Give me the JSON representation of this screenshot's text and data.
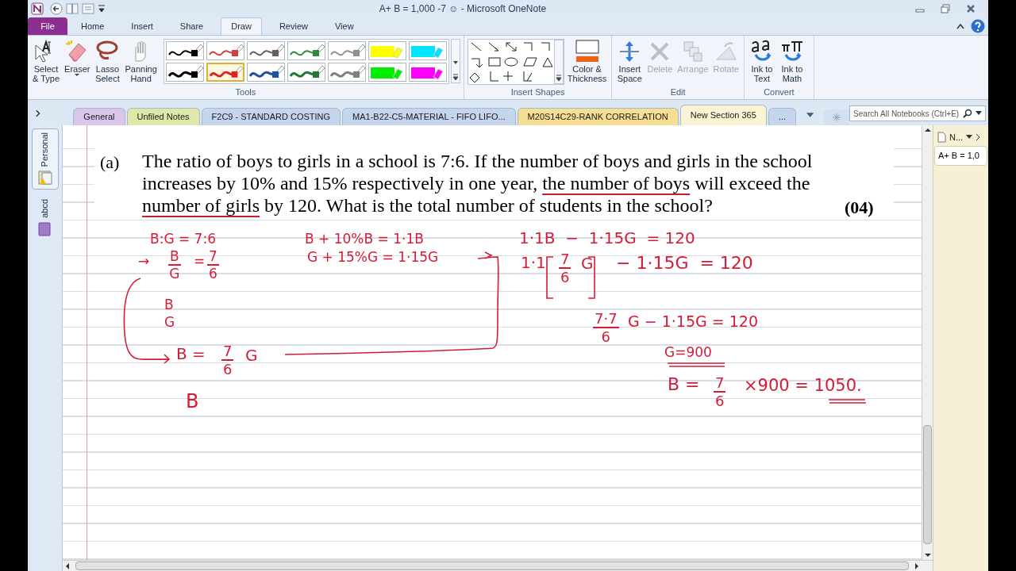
{
  "window": {
    "title": "A+ B = 1,000 -7 ☺  -  Microsoft OneNote"
  },
  "ribbon_tabs": [
    {
      "label": "File",
      "kind": "file",
      "selected": false
    },
    {
      "label": "Home",
      "kind": "tab",
      "selected": false
    },
    {
      "label": "Insert",
      "kind": "tab",
      "selected": false
    },
    {
      "label": "Share",
      "kind": "tab",
      "selected": false
    },
    {
      "label": "Draw",
      "kind": "tab",
      "selected": true
    },
    {
      "label": "Review",
      "kind": "tab",
      "selected": false
    },
    {
      "label": "View",
      "kind": "tab",
      "selected": false
    }
  ],
  "ribbon": {
    "tools": {
      "label": "Tools",
      "buttons": [
        {
          "label": "Select\n& Type",
          "kind": "select"
        },
        {
          "label": "Eraser",
          "kind": "eraser"
        },
        {
          "label": "Lasso\nSelect",
          "kind": "lasso"
        },
        {
          "label": "Panning\nHand",
          "kind": "hand"
        }
      ],
      "pens": [
        {
          "kind": "pen",
          "color": "#000000",
          "selected": false
        },
        {
          "kind": "pen",
          "color": "#d04040",
          "selected": false
        },
        {
          "kind": "pen",
          "color": "#606060",
          "selected": false
        },
        {
          "kind": "pen",
          "color": "#2e8b3e",
          "selected": false
        },
        {
          "kind": "pen",
          "color": "#909090",
          "selected": false
        },
        {
          "kind": "highlighter",
          "color": "#ffff00",
          "selected": false
        },
        {
          "kind": "highlighter",
          "color": "#00e5ff",
          "selected": false
        },
        {
          "kind": "pen",
          "color": "#000000",
          "selected": false
        },
        {
          "kind": "pen",
          "color": "#e02020",
          "selected": true
        },
        {
          "kind": "pen",
          "color": "#2050a0",
          "selected": false
        },
        {
          "kind": "pen",
          "color": "#1f7a30",
          "selected": false
        },
        {
          "kind": "pen",
          "color": "#808080",
          "selected": false
        },
        {
          "kind": "highlighter",
          "color": "#00ee00",
          "selected": false
        },
        {
          "kind": "highlighter",
          "color": "#ff00ff",
          "selected": false
        }
      ]
    },
    "shapes": {
      "label": "Insert Shapes",
      "color_button": "Color &\nThickness"
    },
    "edit": {
      "label": "Edit",
      "buttons": [
        {
          "label": "Insert\nSpace",
          "kind": "space",
          "disabled": false
        },
        {
          "label": "Delete",
          "kind": "delete",
          "disabled": true
        },
        {
          "label": "Arrange",
          "kind": "arrange",
          "disabled": true
        },
        {
          "label": "Rotate",
          "kind": "rotate",
          "disabled": true
        }
      ]
    },
    "convert": {
      "label": "Convert",
      "buttons": [
        {
          "label": "Ink to\nText",
          "kind": "text"
        },
        {
          "label": "Ink to\nMath",
          "kind": "math"
        }
      ]
    }
  },
  "section_tabs": [
    {
      "label": "General",
      "color": "#d9c6ea",
      "selected": false
    },
    {
      "label": "Unfiled Notes",
      "color": "#dfe8a8",
      "selected": false
    },
    {
      "label": "F2C9 - STANDARD COSTING",
      "color": "#c6d5ee",
      "selected": false
    },
    {
      "label": "MA1-B22-C5-MATERIAL - FIFO LIFO...",
      "color": "#c6d5ee",
      "selected": false
    },
    {
      "label": "M20S14C29-RANK CORRELATION",
      "color": "#f6df93",
      "selected": false
    },
    {
      "label": "New Section 365",
      "color": "#fbf3d4",
      "selected": true
    },
    {
      "label": "...",
      "color": "#c6d5ee",
      "selected": false
    }
  ],
  "search": {
    "placeholder": "Search All Notebooks (Ctrl+E)"
  },
  "notebooks": [
    {
      "label": "Personal",
      "selected": true
    },
    {
      "label": "abcd",
      "selected": false
    }
  ],
  "page_list": {
    "new_page": "N...",
    "pages": [
      {
        "label": "A+ B = 1,0",
        "selected": true
      }
    ]
  },
  "question": {
    "label": "(a)",
    "marks": "(04)",
    "segments": [
      {
        "text": "The ratio of boys to girls in a school is 7:6. If the number of boys and girls in the school increases by 10% and 15% respectively in one year, ",
        "underlined": false
      },
      {
        "text": "the number of boys",
        "underlined": true
      },
      {
        "text": " will exceed the ",
        "underlined": false
      },
      {
        "text": "number of girls",
        "underlined": true
      },
      {
        "text": " by 120. What is the total number of students in the school?",
        "underlined": false
      }
    ]
  },
  "ink": [
    {
      "kind": "text",
      "text": "B:G = 7:6"
    },
    {
      "kind": "text",
      "text": "→"
    },
    {
      "kind": "fraction",
      "num": "B",
      "den": "G"
    },
    {
      "kind": "text",
      "text": "="
    },
    {
      "kind": "fraction",
      "num": "7",
      "den": "6"
    },
    {
      "kind": "text",
      "text": "B"
    },
    {
      "kind": "text",
      "text": "G"
    },
    {
      "kind": "text",
      "text": "B ="
    },
    {
      "kind": "fraction",
      "num": "7",
      "den": "6"
    },
    {
      "kind": "text",
      "text": "G"
    },
    {
      "kind": "text",
      "text": "B"
    },
    {
      "kind": "text",
      "text": "B + 10%B = 1·1B"
    },
    {
      "kind": "text",
      "text": "G + 15%G = 1·15G"
    },
    {
      "kind": "text",
      "text": "1·1B  −  1·15G  = 120"
    },
    {
      "kind": "text",
      "text": "1·1"
    },
    {
      "kind": "fraction",
      "num": "7",
      "den": "6"
    },
    {
      "kind": "text",
      "text": "G"
    },
    {
      "kind": "text",
      "text": "− 1·15G  = 120"
    },
    {
      "kind": "fraction",
      "num": "7·7",
      "den": "6"
    },
    {
      "kind": "text",
      "text": "G − 1·15G = 120"
    },
    {
      "kind": "text",
      "text": "G=900"
    },
    {
      "kind": "text",
      "text": "B ="
    },
    {
      "kind": "fraction",
      "num": "7",
      "den": "6"
    },
    {
      "kind": "text",
      "text": "×900 = 1050."
    }
  ]
}
